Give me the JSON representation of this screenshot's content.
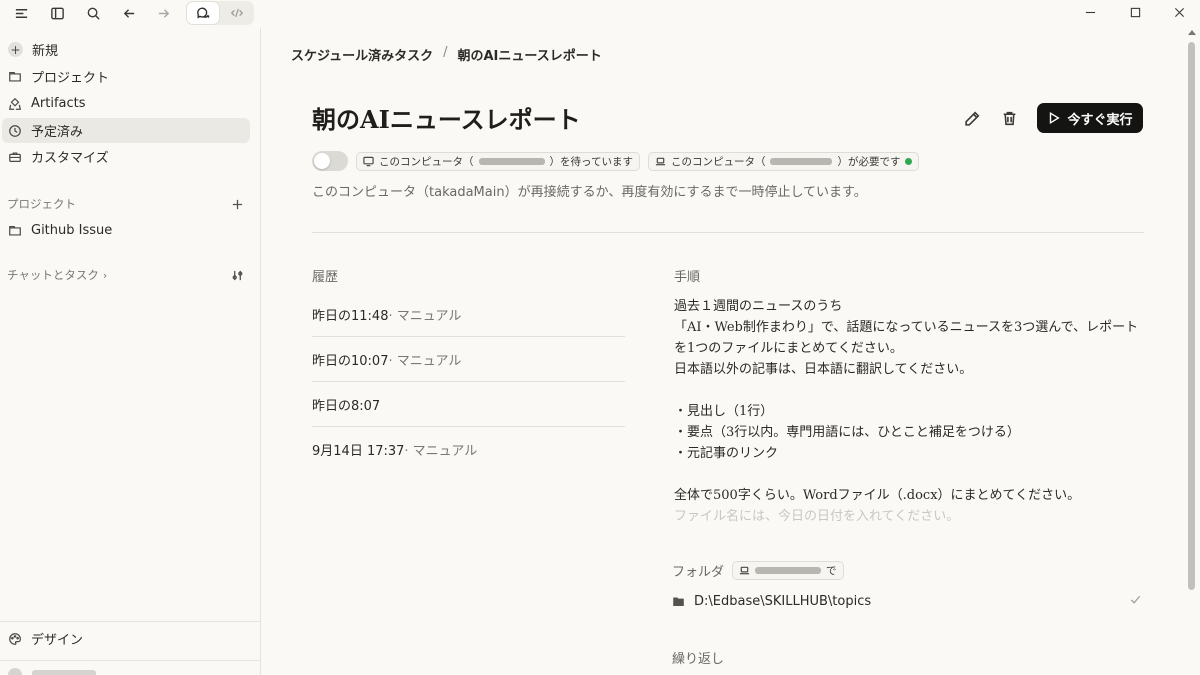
{
  "sidebar": {
    "items": [
      {
        "label": "新規"
      },
      {
        "label": "プロジェクト"
      },
      {
        "label": "Artifacts"
      },
      {
        "label": "予定済み"
      },
      {
        "label": "カスタマイズ"
      }
    ],
    "projects_label": "プロジェクト",
    "project_items": [
      {
        "label": "Github Issue"
      }
    ],
    "chats_label": "チャットとタスク",
    "footer_label": "デザイン"
  },
  "main": {
    "breadcrumb": {
      "parent": "スケジュール済みタスク",
      "separator": "/",
      "current": "朝のAIニュースレポート"
    },
    "title": "朝のAIニュースレポート",
    "run_label": "今すぐ実行",
    "status": {
      "waiting_prefix": "このコンピュータ（",
      "waiting_suffix": "）を待っています",
      "required_prefix": "このコンピュータ（",
      "required_suffix": "）が必要です",
      "status_color": "#2fa84f"
    },
    "subtitle": "このコンピュータ（takadaMain）が再接続するか、再度有効にするまで一時停止しています。",
    "history_label": "履歴",
    "history": [
      {
        "time": "昨日の11:48",
        "mode": " · マニュアル"
      },
      {
        "time": "昨日の10:07",
        "mode": " · マニュアル"
      },
      {
        "time": "昨日の8:07",
        "mode": ""
      },
      {
        "time": "9月14日 17:37",
        "mode": " · マニュアル"
      }
    ],
    "instructions_label": "手順",
    "instructions_text": "過去１週間のニュースのうち\n「AI・Web制作まわり」で、話題になっているニュースを3つ選んで、レポートを1つのファイルにまとめてください。\n日本語以外の記事は、日本語に翻訳してください。\n\n・見出し（1行）\n・要点（3行以内。専門用語には、ひとこと補足をつける）\n・元記事のリンク\n\n全体で500字くらい。Wordファイル（.docx）にまとめてください。",
    "instructions_faded": "ファイル名には、今日の日付を入れてください。",
    "folder_label": "フォルダ",
    "folder_pill_suffix": "で",
    "folder_path": "D:\\Edbase\\SKILLHUB\\topics",
    "repeat_label": "繰り返し"
  }
}
